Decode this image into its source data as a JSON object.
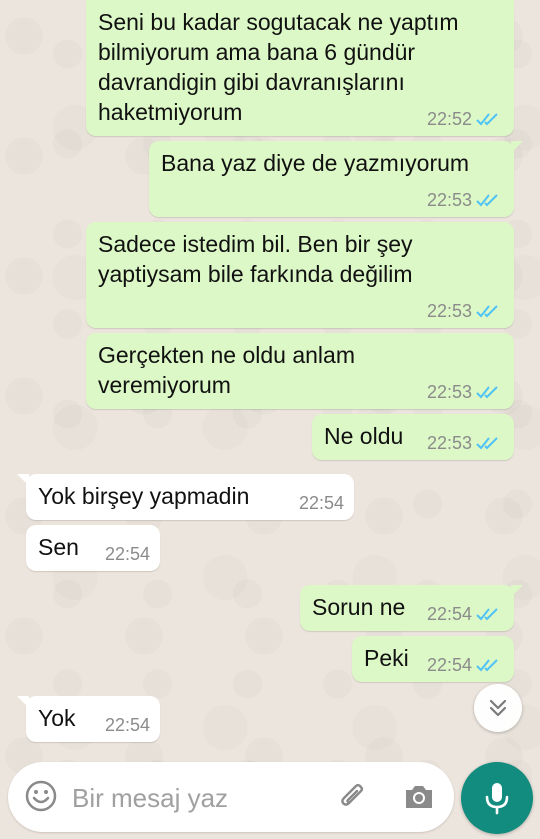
{
  "messages": [
    {
      "direction": "out",
      "text": "Seni bu kadar sogutacak ne yaptım bilmiyorum ama bana 6 gündür davrandigin gibi davranışlarını haketmiyorum",
      "time": "22:52",
      "status": "read"
    },
    {
      "direction": "out",
      "text": "Bana yaz diye de yazmıyorum",
      "time": "22:53",
      "status": "read"
    },
    {
      "direction": "out",
      "text": "Sadece istedim bil. Ben bir şey yaptiysam bile farkında değilim",
      "time": "22:53",
      "status": "read"
    },
    {
      "direction": "out",
      "text": "Gerçekten ne oldu anlam veremiyorum",
      "time": "22:53",
      "status": "read"
    },
    {
      "direction": "out",
      "text": "Ne oldu",
      "time": "22:53",
      "status": "read"
    },
    {
      "direction": "in",
      "text": "Yok birşey yapmadin",
      "time": "22:54"
    },
    {
      "direction": "in",
      "text": "Sen",
      "time": "22:54"
    },
    {
      "direction": "out",
      "text": "Sorun ne",
      "time": "22:54",
      "status": "read"
    },
    {
      "direction": "out",
      "text": "Peki",
      "time": "22:54",
      "status": "read"
    },
    {
      "direction": "in",
      "text": "Yok",
      "time": "22:54"
    }
  ],
  "composer": {
    "placeholder": "Bir mesaj yaz"
  },
  "icons": {
    "emoji": "emoji-icon",
    "attach": "paperclip-icon",
    "camera": "camera-icon",
    "mic": "mic-icon",
    "scroll": "chevron-double-down-icon",
    "read_receipt": "double-check-icon"
  },
  "colors": {
    "outgoing_bubble": "#dcf8c6",
    "incoming_bubble": "#ffffff",
    "read_ticks": "#4fc3f7",
    "mic_button": "#128c7e",
    "wallpaper": "#ece5dd"
  }
}
